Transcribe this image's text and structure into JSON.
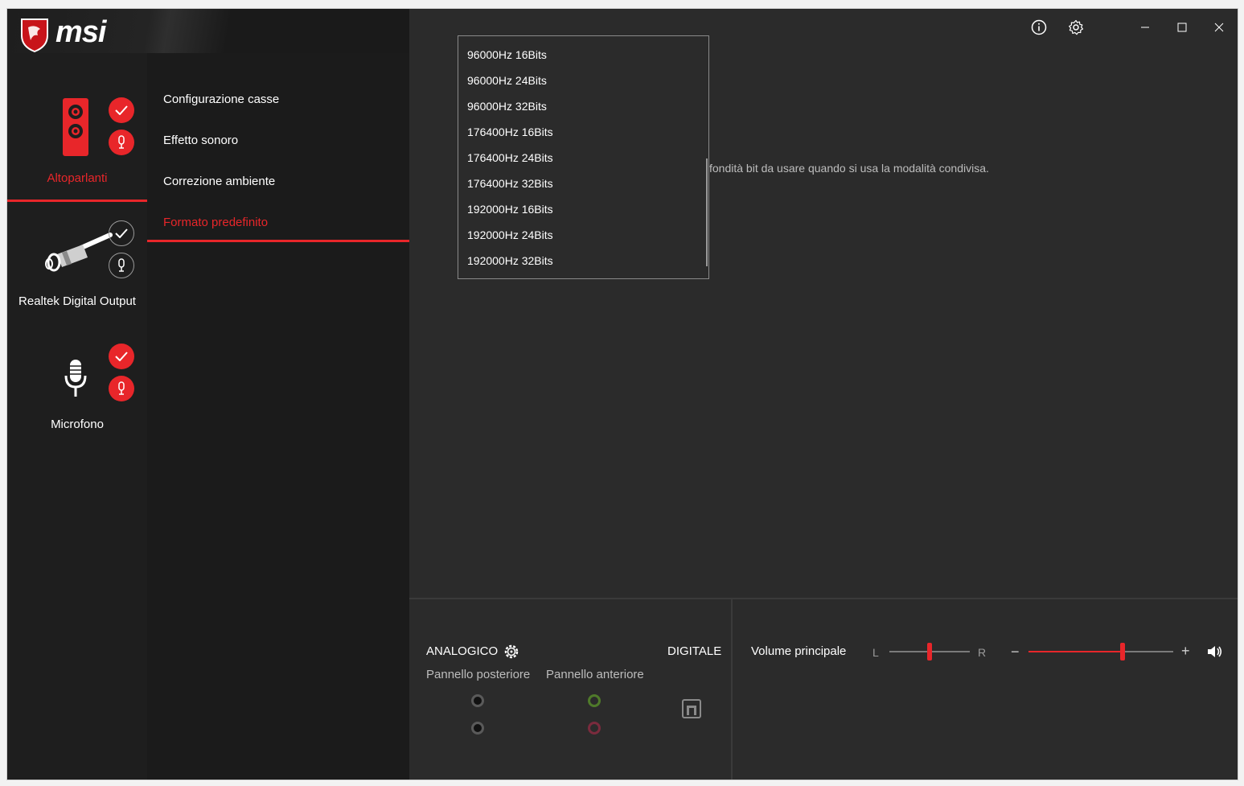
{
  "brand": {
    "logo_text": "msi"
  },
  "devices": [
    {
      "label": "Altoparlanti",
      "active": true
    },
    {
      "label": "Realtek Digital Output",
      "active": false
    },
    {
      "label": "Microfono",
      "active": false
    }
  ],
  "menu": {
    "items": [
      {
        "label": "Configurazione casse"
      },
      {
        "label": "Effetto sonoro"
      },
      {
        "label": "Correzione ambiente"
      },
      {
        "label": "Formato predefinito"
      }
    ],
    "active_index": 3
  },
  "content": {
    "description": "fondità bit da usare quando si usa la modalità condivisa."
  },
  "format_dropdown": {
    "options": [
      "96000Hz 16Bits",
      "96000Hz 24Bits",
      "96000Hz 32Bits",
      "176400Hz 16Bits",
      "176400Hz 24Bits",
      "176400Hz 32Bits",
      "192000Hz 16Bits",
      "192000Hz 24Bits",
      "192000Hz 32Bits"
    ]
  },
  "connectors": {
    "analog_label": "ANALOGICO",
    "digital_label": "DIGITALE",
    "rear_label": "Pannello posteriore",
    "front_label": "Pannello anteriore",
    "front_jack_colors": [
      "#4f7a2a",
      "#7a2b3d"
    ]
  },
  "volume": {
    "label": "Volume principale",
    "balance_left": "L",
    "balance_right": "R",
    "minus": "−",
    "plus": "+",
    "balance_position": 0.5,
    "level": 0.65
  },
  "colors": {
    "accent": "#e8262a"
  }
}
